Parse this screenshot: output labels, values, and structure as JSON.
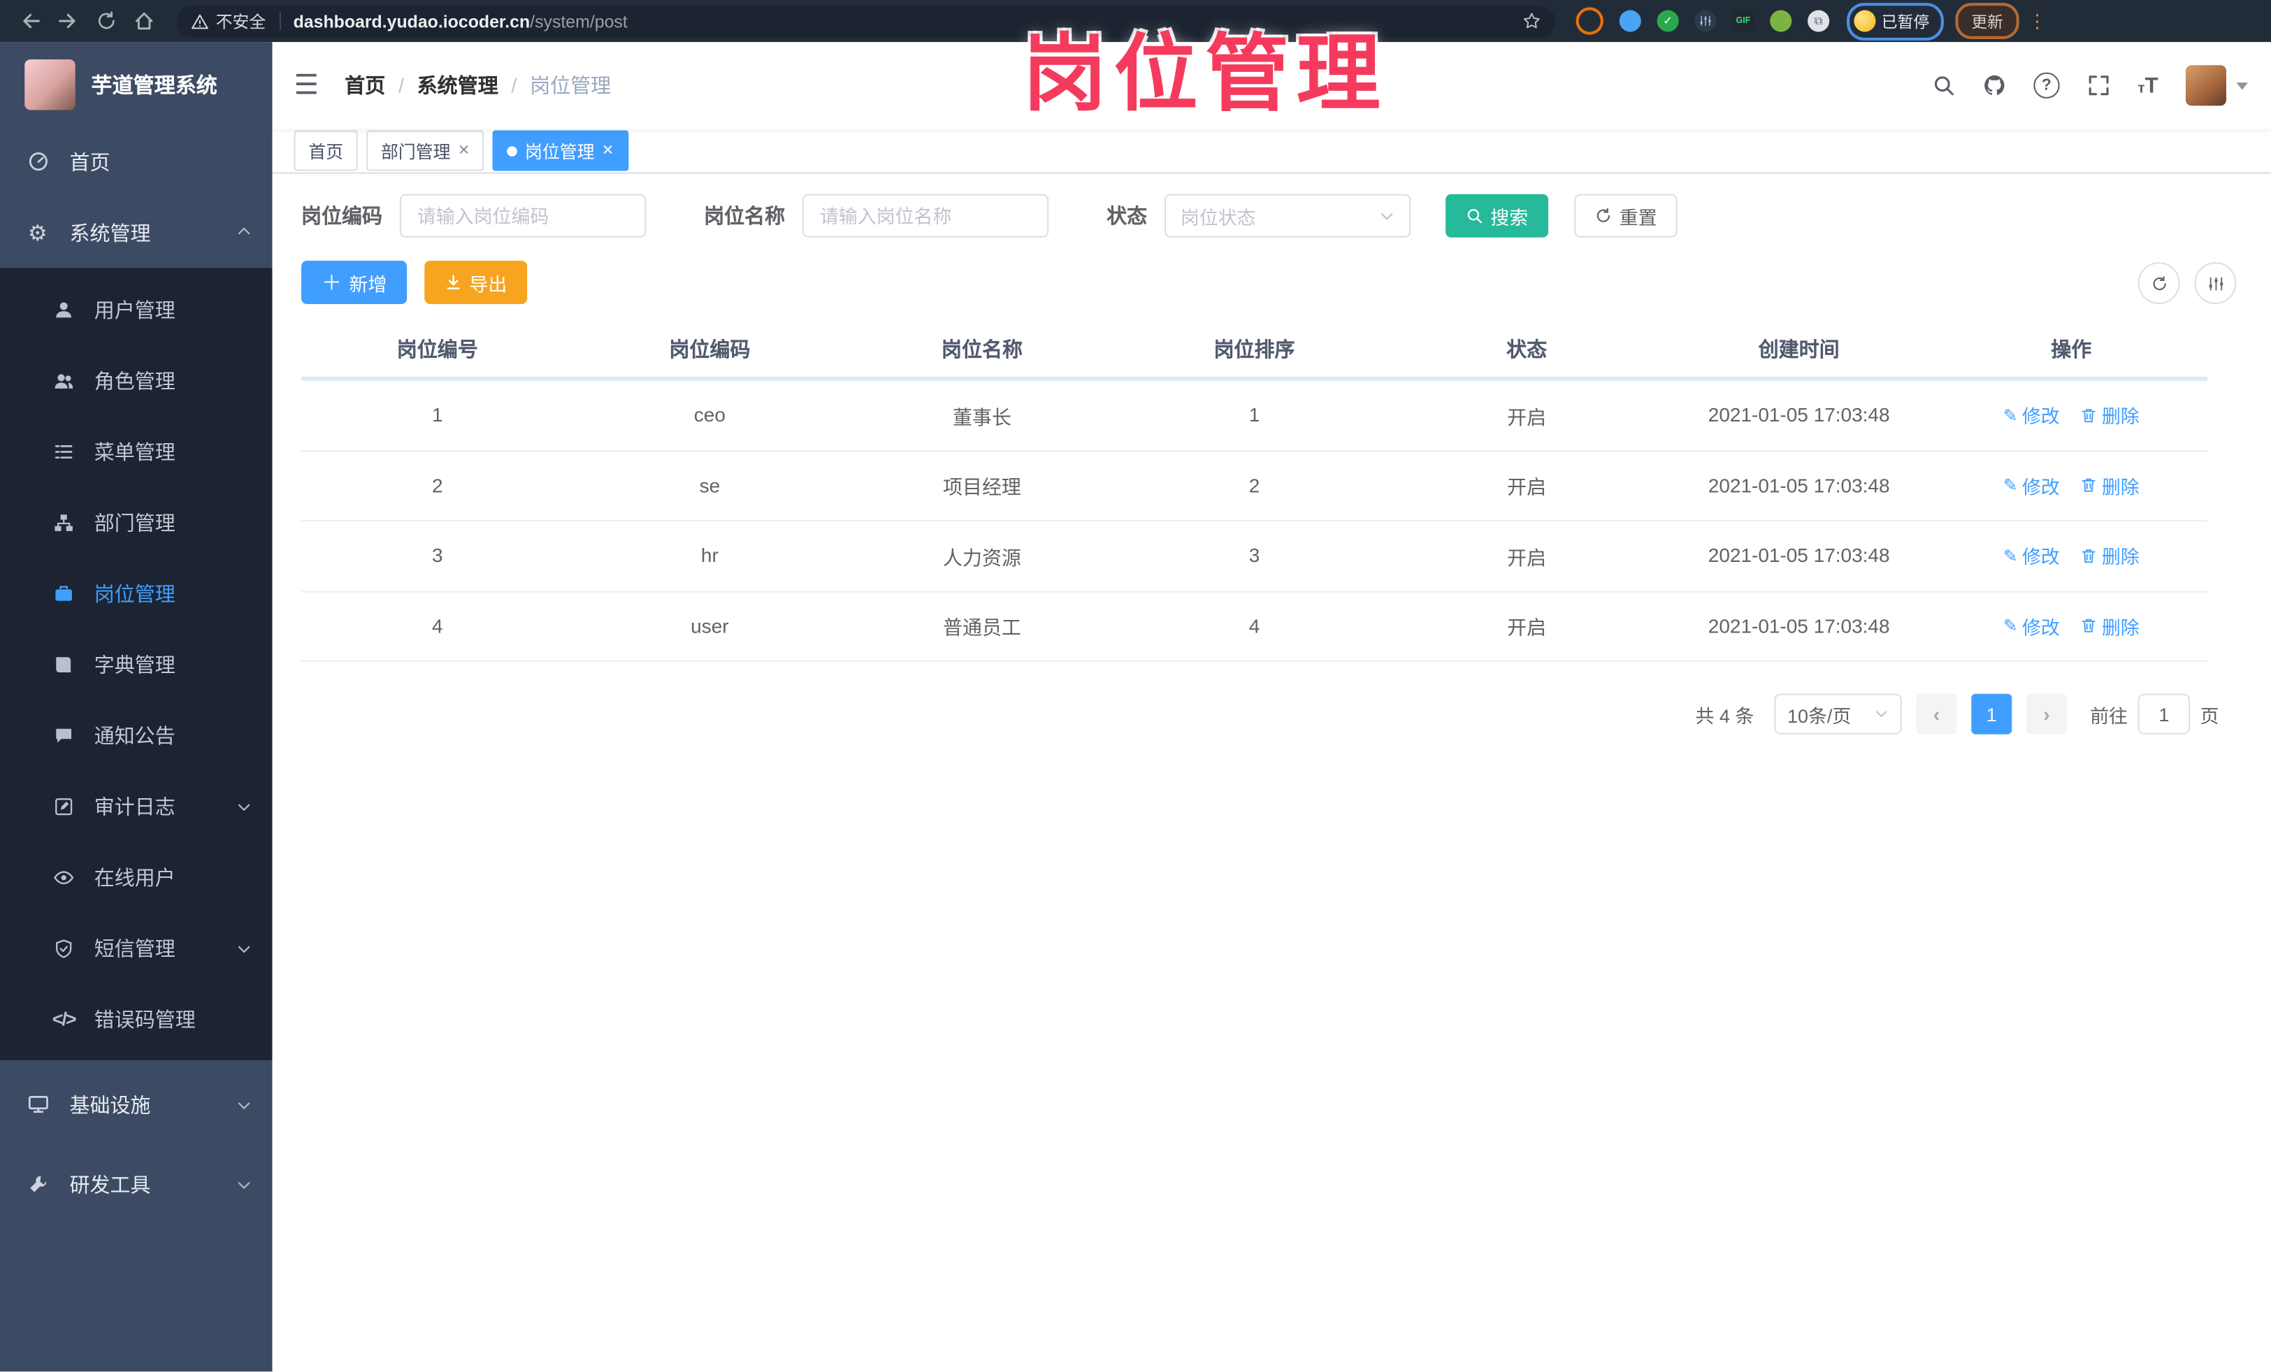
{
  "colors": {
    "accent": "#409eff",
    "search_teal": "#26b99a",
    "export_orange": "#f7a520",
    "overlay_pink": "#f43b5e",
    "sidebar_bg": "#3d4a63",
    "submenu_bg": "#1c2434"
  },
  "browser": {
    "security_label": "不安全",
    "url_host": "dashboard.yudao.iocoder.cn",
    "url_path": "/system/post",
    "profile_status": "已暂停",
    "update_label": "更新"
  },
  "overlay": {
    "title": "岗位管理"
  },
  "sidebar": {
    "app_title": "芋道管理系统",
    "home": {
      "label": "首页",
      "icon": "dashboard-icon"
    },
    "section": {
      "label": "系统管理",
      "icon": "gear-icon"
    },
    "submenu": [
      {
        "label": "用户管理",
        "icon": "user-icon"
      },
      {
        "label": "角色管理",
        "icon": "users-icon"
      },
      {
        "label": "菜单管理",
        "icon": "list-icon"
      },
      {
        "label": "部门管理",
        "icon": "org-tree-icon"
      },
      {
        "label": "岗位管理",
        "icon": "briefcase-icon"
      },
      {
        "label": "字典管理",
        "icon": "book-icon"
      },
      {
        "label": "通知公告",
        "icon": "notice-icon"
      },
      {
        "label": "审计日志",
        "icon": "log-icon"
      },
      {
        "label": "在线用户",
        "icon": "online-icon"
      },
      {
        "label": "短信管理",
        "icon": "sms-icon"
      },
      {
        "label": "错误码管理",
        "icon": "code-icon"
      }
    ],
    "bottom": [
      {
        "label": "基础设施",
        "icon": "monitor-icon"
      },
      {
        "label": "研发工具",
        "icon": "wrench-icon"
      }
    ]
  },
  "header": {
    "breadcrumb": [
      "首页",
      "系统管理",
      "岗位管理"
    ]
  },
  "tabs": [
    {
      "label": "首页"
    },
    {
      "label": "部门管理"
    },
    {
      "label": "岗位管理"
    }
  ],
  "filters": {
    "post_code": {
      "label": "岗位编码",
      "placeholder": "请输入岗位编码"
    },
    "post_name": {
      "label": "岗位名称",
      "placeholder": "请输入岗位名称"
    },
    "status": {
      "label": "状态",
      "placeholder": "岗位状态"
    },
    "search_label": "搜索",
    "reset_label": "重置"
  },
  "toolbar": {
    "add_label": "新增",
    "export_label": "导出"
  },
  "main": {
    "table": {
      "headers": [
        "岗位编号",
        "岗位编码",
        "岗位名称",
        "岗位排序",
        "状态",
        "创建时间",
        "操作"
      ],
      "action_edit": "修改",
      "action_delete": "删除",
      "rows": [
        {
          "id": "1",
          "code": "ceo",
          "name": "董事长",
          "sort": "1",
          "status": "开启",
          "created": "2021-01-05 17:03:48"
        },
        {
          "id": "2",
          "code": "se",
          "name": "项目经理",
          "sort": "2",
          "status": "开启",
          "created": "2021-01-05 17:03:48"
        },
        {
          "id": "3",
          "code": "hr",
          "name": "人力资源",
          "sort": "3",
          "status": "开启",
          "created": "2021-01-05 17:03:48"
        },
        {
          "id": "4",
          "code": "user",
          "name": "普通员工",
          "sort": "4",
          "status": "开启",
          "created": "2021-01-05 17:03:48"
        }
      ]
    },
    "pagination": {
      "total": "共 4 条",
      "page_size": "10条/页",
      "current_page": "1",
      "goto_label": "前往",
      "goto_value": "1",
      "page_unit": "页"
    }
  }
}
